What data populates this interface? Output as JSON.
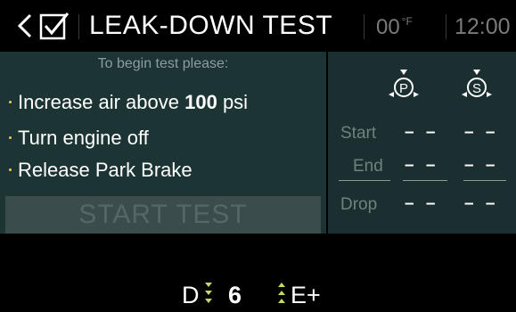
{
  "header": {
    "title": "LEAK-DOWN TEST",
    "temperature": "00",
    "temperature_unit": "°F",
    "clock": "12:00"
  },
  "instructions": {
    "heading": "To begin test please:",
    "items": [
      {
        "text_before": "Increase air above ",
        "bold": "100",
        "text_after": " psi"
      },
      {
        "text": "Turn engine off"
      },
      {
        "text": "Release Park Brake"
      }
    ],
    "start_button": "START TEST"
  },
  "readings": {
    "rows": [
      {
        "label": "Start",
        "primary": "– –",
        "secondary": "– –"
      },
      {
        "label": "End",
        "primary": "– –",
        "secondary": "– –"
      },
      {
        "label": "Drop",
        "primary": "– –",
        "secondary": "– –"
      }
    ],
    "gauge_primary": "P",
    "gauge_secondary": "S"
  },
  "status_bar": {
    "gear_current": "D",
    "gear_number": "6",
    "gear_mode": "E+"
  },
  "colors": {
    "panel_bg": "#1d3434",
    "accent_dot": "#e4cf55",
    "arrow_green": "#c9d76a",
    "dim_text": "#7a7a7a"
  },
  "icons": [
    "back-chevron-icon",
    "checkbox-icon",
    "primary-pressure-gauge-icon",
    "secondary-pressure-gauge-icon",
    "shift-down-arrow-icon",
    "shift-up-arrow-icon"
  ]
}
